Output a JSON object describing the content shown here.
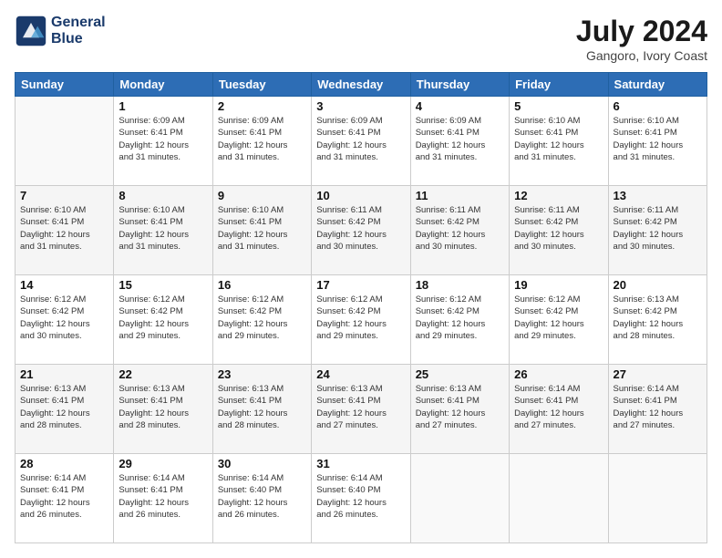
{
  "header": {
    "logo_line1": "General",
    "logo_line2": "Blue",
    "title": "July 2024",
    "subtitle": "Gangoro, Ivory Coast"
  },
  "days_of_week": [
    "Sunday",
    "Monday",
    "Tuesday",
    "Wednesday",
    "Thursday",
    "Friday",
    "Saturday"
  ],
  "weeks": [
    [
      {
        "day": "",
        "info": ""
      },
      {
        "day": "1",
        "info": "Sunrise: 6:09 AM\nSunset: 6:41 PM\nDaylight: 12 hours\nand 31 minutes."
      },
      {
        "day": "2",
        "info": "Sunrise: 6:09 AM\nSunset: 6:41 PM\nDaylight: 12 hours\nand 31 minutes."
      },
      {
        "day": "3",
        "info": "Sunrise: 6:09 AM\nSunset: 6:41 PM\nDaylight: 12 hours\nand 31 minutes."
      },
      {
        "day": "4",
        "info": "Sunrise: 6:09 AM\nSunset: 6:41 PM\nDaylight: 12 hours\nand 31 minutes."
      },
      {
        "day": "5",
        "info": "Sunrise: 6:10 AM\nSunset: 6:41 PM\nDaylight: 12 hours\nand 31 minutes."
      },
      {
        "day": "6",
        "info": "Sunrise: 6:10 AM\nSunset: 6:41 PM\nDaylight: 12 hours\nand 31 minutes."
      }
    ],
    [
      {
        "day": "7",
        "info": ""
      },
      {
        "day": "8",
        "info": "Sunrise: 6:10 AM\nSunset: 6:41 PM\nDaylight: 12 hours\nand 31 minutes."
      },
      {
        "day": "9",
        "info": "Sunrise: 6:10 AM\nSunset: 6:41 PM\nDaylight: 12 hours\nand 31 minutes."
      },
      {
        "day": "10",
        "info": "Sunrise: 6:11 AM\nSunset: 6:42 PM\nDaylight: 12 hours\nand 30 minutes."
      },
      {
        "day": "11",
        "info": "Sunrise: 6:11 AM\nSunset: 6:42 PM\nDaylight: 12 hours\nand 30 minutes."
      },
      {
        "day": "12",
        "info": "Sunrise: 6:11 AM\nSunset: 6:42 PM\nDaylight: 12 hours\nand 30 minutes."
      },
      {
        "day": "13",
        "info": "Sunrise: 6:11 AM\nSunset: 6:42 PM\nDaylight: 12 hours\nand 30 minutes."
      }
    ],
    [
      {
        "day": "14",
        "info": ""
      },
      {
        "day": "15",
        "info": "Sunrise: 6:12 AM\nSunset: 6:42 PM\nDaylight: 12 hours\nand 29 minutes."
      },
      {
        "day": "16",
        "info": "Sunrise: 6:12 AM\nSunset: 6:42 PM\nDaylight: 12 hours\nand 29 minutes."
      },
      {
        "day": "17",
        "info": "Sunrise: 6:12 AM\nSunset: 6:42 PM\nDaylight: 12 hours\nand 29 minutes."
      },
      {
        "day": "18",
        "info": "Sunrise: 6:12 AM\nSunset: 6:42 PM\nDaylight: 12 hours\nand 29 minutes."
      },
      {
        "day": "19",
        "info": "Sunrise: 6:12 AM\nSunset: 6:42 PM\nDaylight: 12 hours\nand 29 minutes."
      },
      {
        "day": "20",
        "info": "Sunrise: 6:13 AM\nSunset: 6:42 PM\nDaylight: 12 hours\nand 28 minutes."
      }
    ],
    [
      {
        "day": "21",
        "info": ""
      },
      {
        "day": "22",
        "info": "Sunrise: 6:13 AM\nSunset: 6:41 PM\nDaylight: 12 hours\nand 28 minutes."
      },
      {
        "day": "23",
        "info": "Sunrise: 6:13 AM\nSunset: 6:41 PM\nDaylight: 12 hours\nand 28 minutes."
      },
      {
        "day": "24",
        "info": "Sunrise: 6:13 AM\nSunset: 6:41 PM\nDaylight: 12 hours\nand 27 minutes."
      },
      {
        "day": "25",
        "info": "Sunrise: 6:13 AM\nSunset: 6:41 PM\nDaylight: 12 hours\nand 27 minutes."
      },
      {
        "day": "26",
        "info": "Sunrise: 6:14 AM\nSunset: 6:41 PM\nDaylight: 12 hours\nand 27 minutes."
      },
      {
        "day": "27",
        "info": "Sunrise: 6:14 AM\nSunset: 6:41 PM\nDaylight: 12 hours\nand 27 minutes."
      }
    ],
    [
      {
        "day": "28",
        "info": "Sunrise: 6:14 AM\nSunset: 6:41 PM\nDaylight: 12 hours\nand 26 minutes."
      },
      {
        "day": "29",
        "info": "Sunrise: 6:14 AM\nSunset: 6:41 PM\nDaylight: 12 hours\nand 26 minutes."
      },
      {
        "day": "30",
        "info": "Sunrise: 6:14 AM\nSunset: 6:40 PM\nDaylight: 12 hours\nand 26 minutes."
      },
      {
        "day": "31",
        "info": "Sunrise: 6:14 AM\nSunset: 6:40 PM\nDaylight: 12 hours\nand 26 minutes."
      },
      {
        "day": "",
        "info": ""
      },
      {
        "day": "",
        "info": ""
      },
      {
        "day": "",
        "info": ""
      }
    ]
  ],
  "week1_day7_info": "Sunrise: 6:10 AM\nSunset: 6:41 PM\nDaylight: 12 hours\nand 31 minutes.",
  "week2_day14_info": "Sunrise: 6:12 AM\nSunset: 6:42 PM\nDaylight: 12 hours\nand 30 minutes.",
  "week3_day21_info": "Sunrise: 6:13 AM\nSunset: 6:41 PM\nDaylight: 12 hours\nand 28 minutes."
}
